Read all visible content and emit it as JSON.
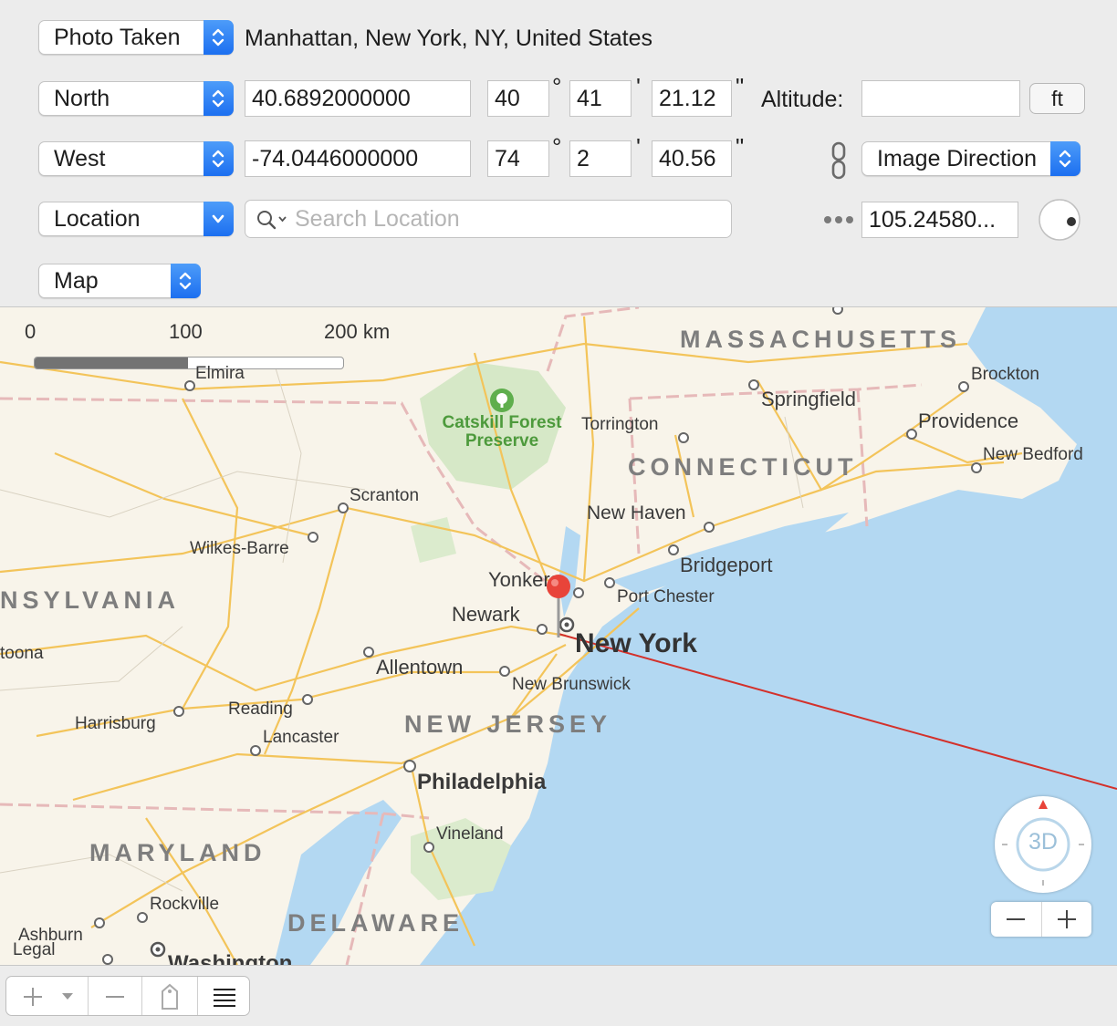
{
  "row1": {
    "date_popup": "Photo Taken",
    "location_text": "Manhattan, New York, NY, United States"
  },
  "lat": {
    "hemisphere": "North",
    "decimal": "40.6892000000",
    "deg": "40",
    "min": "41",
    "sec": "21.12"
  },
  "altitude": {
    "label": "Altitude:",
    "value": "",
    "unit": "ft"
  },
  "lon": {
    "hemisphere": "West",
    "decimal": "-74.0446000000",
    "deg": "74",
    "min": "2",
    "sec": "40.56"
  },
  "direction": {
    "popup": "Image Direction",
    "value": "105.24580..."
  },
  "units": {
    "deg": "°",
    "min": "'",
    "sec": "\""
  },
  "location_row": {
    "popup": "Location",
    "search_placeholder": "Search Location"
  },
  "view_popup": "Map",
  "scale": {
    "l0": "0",
    "l1": "100",
    "l2": "200 km"
  },
  "map": {
    "states": [
      "MASSACHUSETTS",
      "CONNECTICUT",
      "NSYLVANIA",
      "NEW JERSEY",
      "MARYLAND",
      "DELAWARE"
    ],
    "cities": [
      "Elmira",
      "Brockton",
      "Springfield",
      "Providence",
      "Torrington",
      "New Bedford",
      "Scranton",
      "New Haven",
      "Wilkes-Barre",
      "Bridgeport",
      "Yonkers",
      "Port Chester",
      "Newark",
      "toona",
      "Allentown",
      "New Brunswick",
      "Reading",
      "Harrisburg",
      "Lancaster",
      "Philadelphia",
      "Vineland",
      "Rockville",
      "Ashburn",
      "Legal",
      "Washington"
    ],
    "major_city": "New York",
    "park": "Catskill Forest Preserve",
    "compass_3d": "3D"
  },
  "colors": {
    "accent": "#1c6ff0",
    "water": "#b3d8f2",
    "land": "#f8f4ea",
    "road": "#f3c45a",
    "pin": "#e8443a",
    "direction_line": "#d3312b"
  }
}
